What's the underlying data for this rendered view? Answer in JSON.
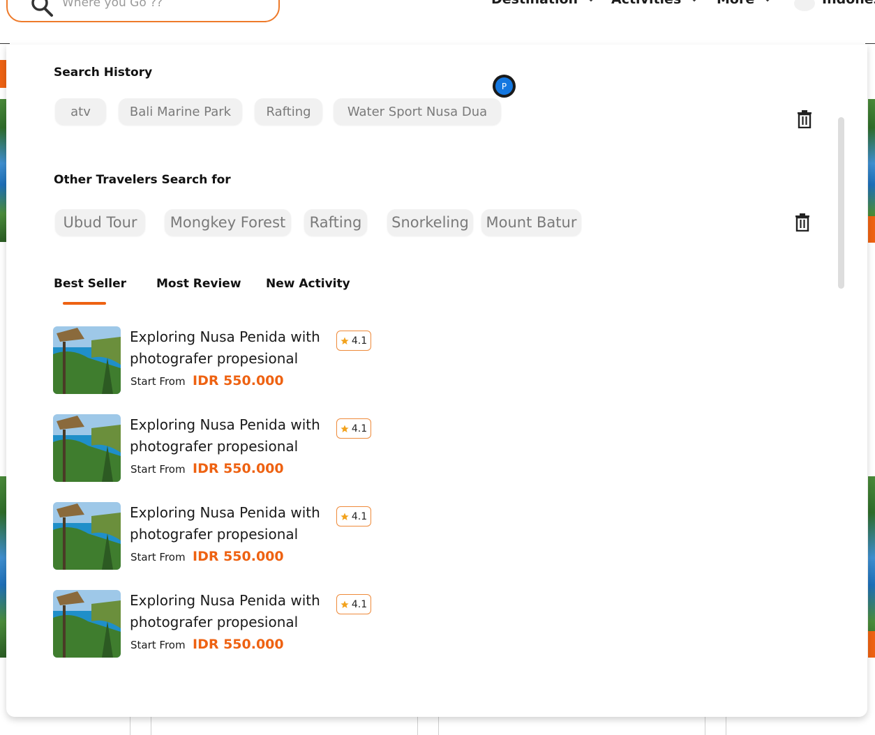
{
  "header": {
    "search_placeholder": "Where you Go ??",
    "nav": [
      {
        "label": "Destination"
      },
      {
        "label": "Activities"
      },
      {
        "label": "More"
      }
    ],
    "language_label": "Indones"
  },
  "search_history": {
    "title": "Search History",
    "chips": [
      "atv",
      "Bali Marine Park",
      "Rafting",
      "Water Sport Nusa Dua"
    ]
  },
  "other_travelers": {
    "title": "Other Travelers Search for",
    "chips": [
      "Ubud Tour",
      "Mongkey Forest",
      "Rafting",
      "Snorkeling",
      "Mount Batur"
    ]
  },
  "avatar_initial": "P",
  "tabs": [
    {
      "label": "Best Seller",
      "active": true
    },
    {
      "label": "Most Review",
      "active": false
    },
    {
      "label": "New Activity",
      "active": false
    }
  ],
  "products": [
    {
      "title": "Exploring Nusa Penida with photografer propesional",
      "rating": "4.1",
      "start_from_label": "Start From",
      "price": "IDR 550.000"
    },
    {
      "title": "Exploring Nusa Penida with photografer propesional",
      "rating": "4.1",
      "start_from_label": "Start From",
      "price": "IDR 550.000"
    },
    {
      "title": "Exploring Nusa Penida with photografer propesional",
      "rating": "4.1",
      "start_from_label": "Start From",
      "price": "IDR 550.000"
    },
    {
      "title": "Exploring Nusa Penida with photografer propesional",
      "rating": "4.1",
      "start_from_label": "Start From",
      "price": "IDR 550.000"
    }
  ],
  "colors": {
    "accent": "#ee6212",
    "search_border": "#ee7a2a",
    "chip_bg": "#f1f1f1",
    "chip_text": "#7a7a7a",
    "avatar_blue": "#1477e0"
  },
  "icons": [
    "search-icon",
    "chevron-down-icon",
    "trash-icon",
    "star-icon"
  ]
}
